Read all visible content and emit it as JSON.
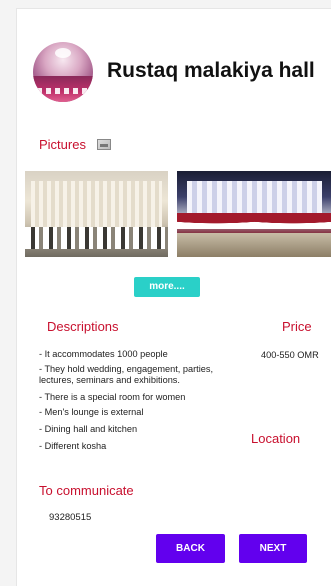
{
  "header": {
    "title": "Rustaq malakiya hall"
  },
  "gallery": {
    "label": "Pictures",
    "more_label": "more....",
    "icon": "image-icon"
  },
  "details": {
    "descriptions_label": "Descriptions",
    "price_label": "Price",
    "price_value": "400-550 OMR",
    "location_label": "Location",
    "descriptions": [
      "- It accommodates 1000 people",
      "- They hold wedding, engagement, parties, lectures, seminars and exhibitions.",
      "- There is a special room for women",
      "- Men's lounge is external",
      "- Dining hall and kitchen",
      "- Different kosha"
    ]
  },
  "contact": {
    "label": "To communicate",
    "phone": "93280515"
  },
  "actions": {
    "back_label": "BACK",
    "next_label": "NEXT"
  },
  "colors": {
    "accent_red": "#c8102e",
    "more_button": "#2ad0c8",
    "primary_button": "#6200ee"
  }
}
